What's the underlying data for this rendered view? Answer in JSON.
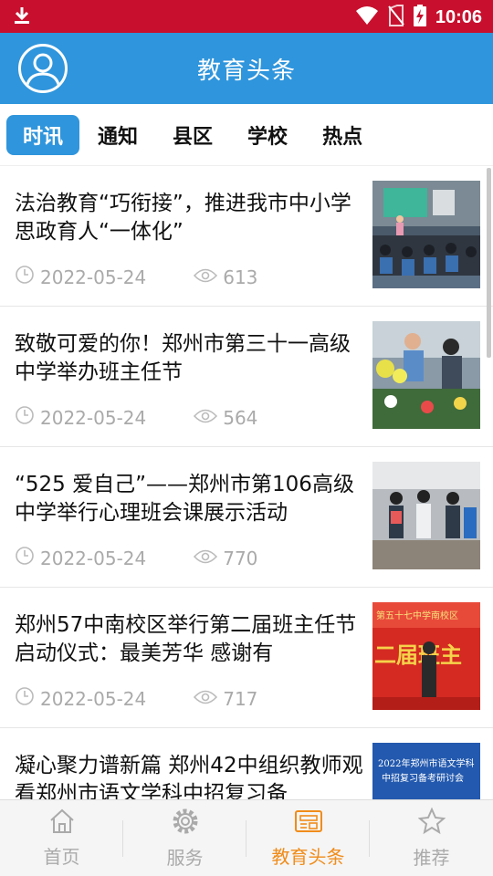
{
  "status_bar": {
    "time": "10:06"
  },
  "header": {
    "title": "教育头条"
  },
  "tabs": [
    {
      "label": "时讯",
      "active": true
    },
    {
      "label": "通知",
      "active": false
    },
    {
      "label": "县区",
      "active": false
    },
    {
      "label": "学校",
      "active": false
    },
    {
      "label": "热点",
      "active": false
    }
  ],
  "news": [
    {
      "title": "法治教育“巧衔接”，推进我市中小学思政育人“一体化”",
      "date": "2022-05-24",
      "views": "613"
    },
    {
      "title": "致敬可爱的你！郑州市第三十一高级中学举办班主任节",
      "date": "2022-05-24",
      "views": "564"
    },
    {
      "title": "“525 爱自己”——郑州市第106高级中学举行心理班会课展示活动",
      "date": "2022-05-24",
      "views": "770"
    },
    {
      "title": "郑州57中南校区举行第二届班主任节启动仪式：最美芳华 感谢有",
      "date": "2022-05-24",
      "views": "717"
    },
    {
      "title": "凝心聚力谱新篇 郑州42中组织教师观看郑州市语文学科中招复习备",
      "date": "",
      "views": ""
    }
  ],
  "thumb_texts": {
    "t4": "第五十七中学南校区",
    "t4b": "二届班主",
    "t5a": "2022年郑州市语文学科",
    "t5b": "中招复习备考研讨会"
  },
  "bottom_nav": [
    {
      "label": "首页",
      "icon": "home-icon",
      "active": false
    },
    {
      "label": "服务",
      "icon": "gear-icon",
      "active": false
    },
    {
      "label": "教育头条",
      "icon": "newspaper-icon",
      "active": true
    },
    {
      "label": "推荐",
      "icon": "star-icon",
      "active": false
    }
  ],
  "colors": {
    "status_bar": "#c8102e",
    "header": "#2f95dc",
    "active_nav": "#f08c1a"
  }
}
